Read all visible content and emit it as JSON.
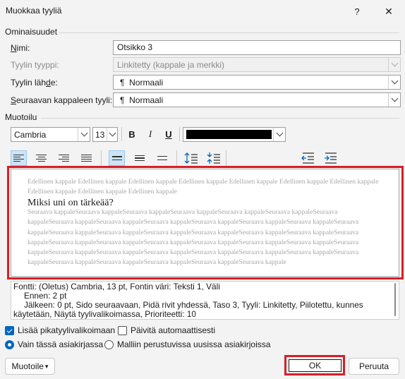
{
  "dialog": {
    "title": "Muokkaa tyyliä",
    "help_button": "?",
    "close_button": "✕"
  },
  "properties": {
    "group_label": "Ominaisuudet",
    "name_label_ul": "N",
    "name_label_rest": "imi:",
    "name_value": "Otsikko 3",
    "type_label": "Tyylin tyyppi:",
    "type_value": "Linkitetty (kappale ja merkki)",
    "based_label_pre": "Tyylin läh",
    "based_label_ul": "d",
    "based_label_post": "e:",
    "based_value": "Normaali",
    "next_label_ul": "S",
    "next_label_rest": "euraavan kappaleen tyyli:",
    "next_value": "Normaali",
    "pilcrow": "¶"
  },
  "formatting": {
    "group_label": "Muotoilu",
    "font_name": "Cambria",
    "font_size": "13",
    "bold": "B",
    "italic": "I",
    "underline": "U",
    "font_color": "#000000"
  },
  "preview": {
    "prev_para": "Edellinen kappale Edellinen kappale Edellinen kappale Edellinen kappale Edellinen kappale Edellinen kappale Edellinen kappale Edellinen kappale Edellinen kappale Edellinen kappale",
    "heading": "Miksi uni on tärkeää?",
    "next_para": "Seuraava kappaleSeuraava kappaleSeuraava kappaleSeuraava kappaleSeuraava kappaleSeuraava kappaleSeuraava kappaleSeuraava kappaleSeuraava kappaleSeuraava kappaleSeuraava kappaleSeuraava kappaleSeuraava kappaleSeuraava kappaleSeuraava kappaleSeuraava kappaleSeuraava kappaleSeuraava kappaleSeuraava kappaleSeuraava kappaleSeuraava kappaleSeuraava kappaleSeuraava kappaleSeuraava kappaleSeuraava kappaleSeuraava kappaleSeuraava kappaleSeuraava kappaleSeuraava kappaleSeuraava kappaleSeuraava kappaleSeuraava kappaleSeuraava kappaleSeuraava kappaleSeuraava kappaleSeuraava kappaleSeuraava kappaleSeuraava kappaleSeuraava kappaleSeuraava kappale"
  },
  "description": {
    "line1": "Fontti: (Oletus) Cambria, 13 pt, Fontin väri: Teksti 1, Väli",
    "line2": "Ennen:  2 pt",
    "line3": "Jälkeen:  0 pt, Sido seuraavaan, Pidä rivit yhdessä, Taso 3, Tyyli: Linkitetty, Piilotettu, kunnes",
    "line4": "käytetään, Näytä tyylivalikoimassa, Prioriteetti: 10"
  },
  "options": {
    "add_gallery": "Lisää pikatyylivalikoimaan",
    "add_gallery_checked": true,
    "auto_update": "Päivitä automaattisesti",
    "auto_update_checked": false,
    "this_doc": "Vain tässä asiakirjassa",
    "this_doc_selected": true,
    "new_docs": "Malliin perustuvissa uusissa asiakirjoissa",
    "new_docs_selected": false
  },
  "buttons": {
    "format": "Muotoile",
    "format_arrow": "▾",
    "ok": "OK",
    "cancel": "Peruuta"
  },
  "colors": {
    "accent": "#0067c0",
    "highlight_border": "#d61f26"
  }
}
